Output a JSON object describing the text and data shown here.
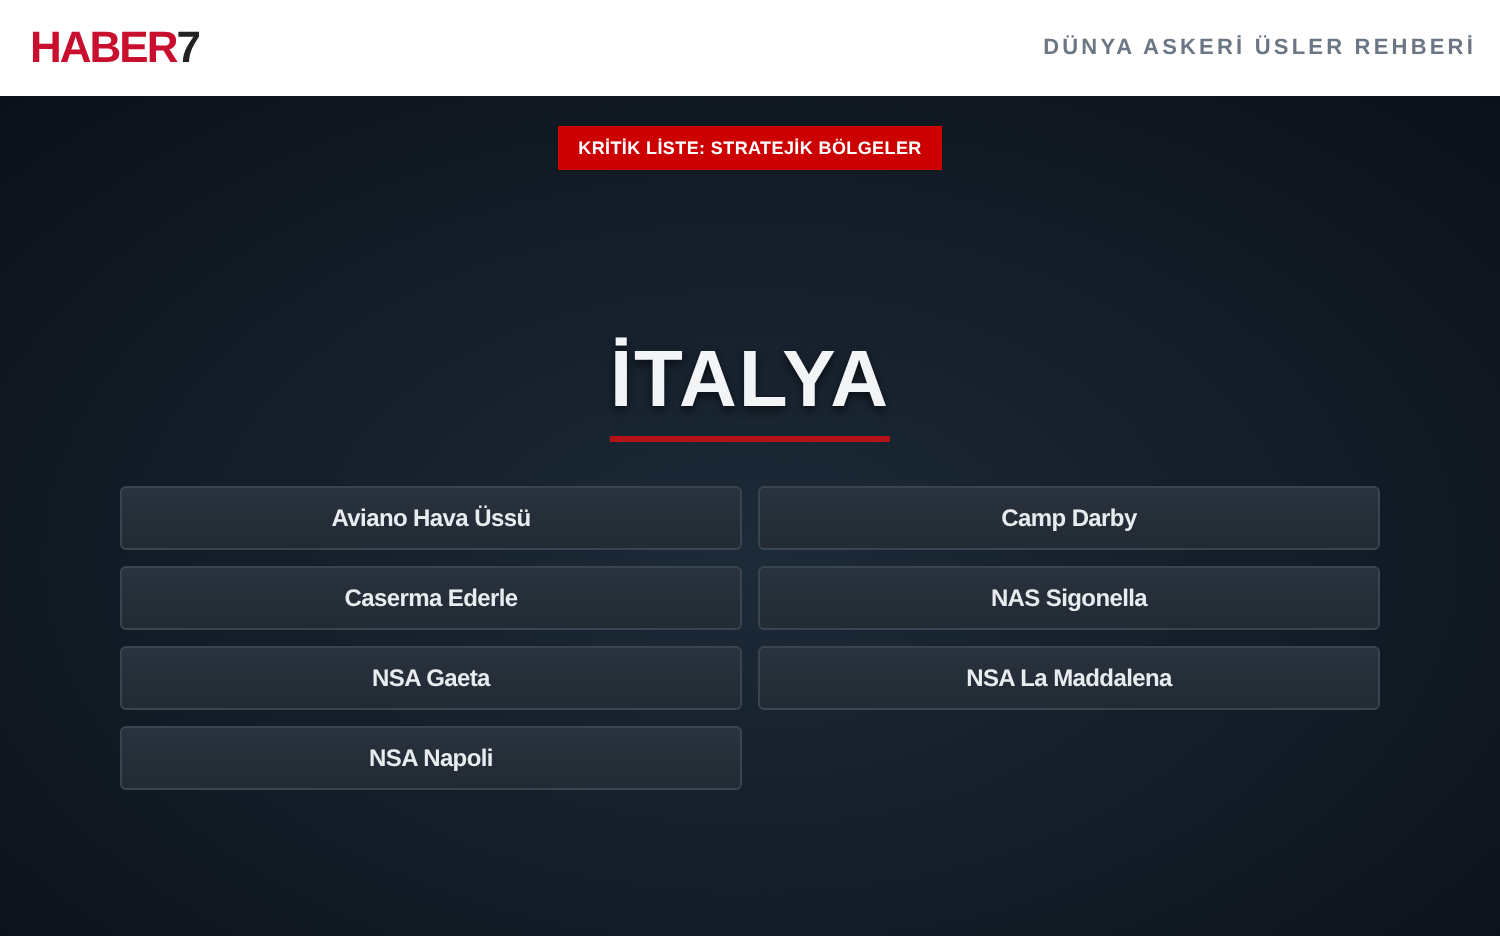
{
  "header": {
    "logo": {
      "text": "HABER",
      "accent": "7"
    },
    "section_title": "DÜNYA ASKERİ ÜSLER REHBERİ"
  },
  "badge": "KRİTİK LİSTE: STRATEJİK BÖLGELER",
  "country": "İTALYA",
  "bases": [
    {
      "label": "Aviano Hava Üssü"
    },
    {
      "label": "Camp Darby"
    },
    {
      "label": "Caserma Ederle"
    },
    {
      "label": "NAS Sigonella"
    },
    {
      "label": "NSA Gaeta"
    },
    {
      "label": "NSA La Maddalena"
    },
    {
      "label": "NSA Napoli"
    }
  ]
}
